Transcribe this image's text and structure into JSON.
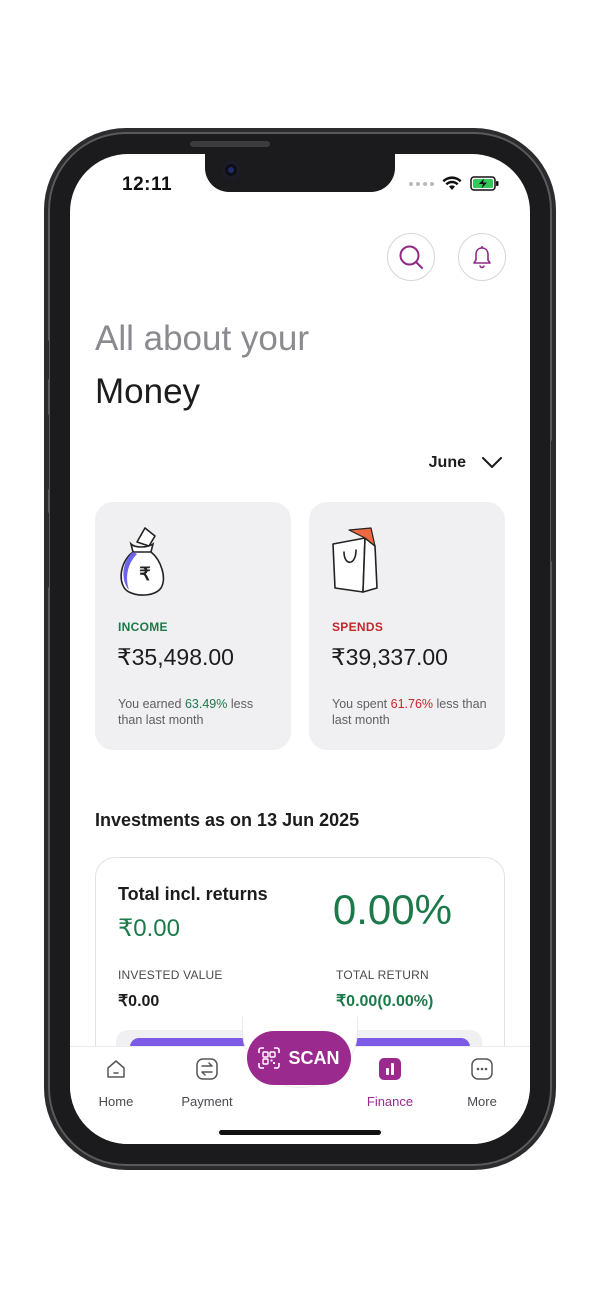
{
  "status": {
    "time": "12:11"
  },
  "header": {
    "search_icon": "search-icon",
    "bell_icon": "bell-icon"
  },
  "hero": {
    "line1": "All about your",
    "line2": "Money"
  },
  "month_filter": {
    "value": "June"
  },
  "income": {
    "title": "INCOME",
    "amount": "₹35,498.00",
    "note_prefix": "You earned ",
    "pct": "63.49%",
    "note_suffix": " less than last month"
  },
  "spends": {
    "title": "SPENDS",
    "amount": "₹39,337.00",
    "note_prefix": "You spent ",
    "pct": "61.76%",
    "note_suffix": " less than last month"
  },
  "investments": {
    "title": "Investments as on 13 Jun 2025",
    "total_label": "Total incl. returns",
    "total_value": "₹0.00",
    "return_pct": "0.00%",
    "invested_label": "INVESTED VALUE",
    "invested_value": "₹0.00",
    "total_return_label": "TOTAL RETURN",
    "total_return_value": "₹0.00(0.00%)"
  },
  "nav": {
    "home": "Home",
    "payment": "Payment",
    "scan": "SCAN",
    "finance": "Finance",
    "more": "More"
  },
  "colors": {
    "brand": "#9b2a8f",
    "green": "#1c7a4a",
    "red": "#c0282c",
    "card_bg": "#f0f0f2"
  }
}
